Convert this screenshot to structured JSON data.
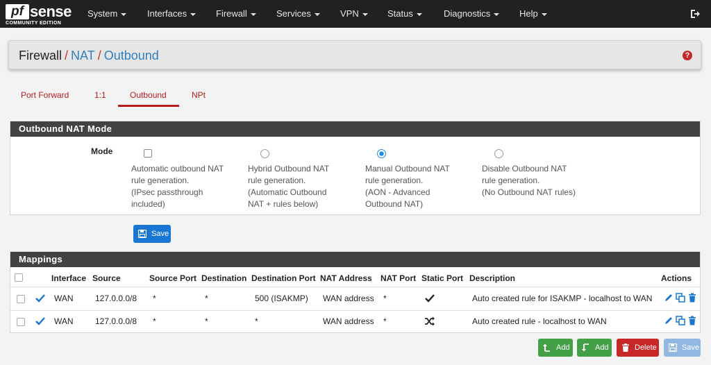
{
  "brand": {
    "logo": "pfsense",
    "logo_pf": "pf",
    "logo_sense": "sense",
    "edition": "COMMUNITY EDITION"
  },
  "nav": {
    "items": [
      {
        "label": "System"
      },
      {
        "label": "Interfaces"
      },
      {
        "label": "Firewall"
      },
      {
        "label": "Services"
      },
      {
        "label": "VPN"
      },
      {
        "label": "Status"
      },
      {
        "label": "Diagnostics"
      },
      {
        "label": "Help"
      }
    ],
    "logout_icon": "logout-icon"
  },
  "breadcrumb": {
    "root": "Firewall",
    "sep": "/",
    "level2": "NAT",
    "level3": "Outbound",
    "help_icon": "?"
  },
  "tabs": [
    {
      "label": "Port Forward"
    },
    {
      "label": "1:1"
    },
    {
      "label": "Outbound",
      "active": true
    },
    {
      "label": "NPt"
    }
  ],
  "mode_panel": {
    "title": "Outbound NAT Mode",
    "label": "Mode",
    "options": [
      {
        "control": "checkbox",
        "checked": false,
        "lines": [
          "Automatic outbound NAT",
          "rule generation.",
          "(IPsec passthrough",
          "included)"
        ]
      },
      {
        "control": "radio",
        "checked": false,
        "lines": [
          "Hybrid Outbound NAT",
          "rule generation.",
          "(Automatic Outbound",
          "NAT + rules below)"
        ]
      },
      {
        "control": "radio",
        "checked": true,
        "lines": [
          "Manual Outbound NAT",
          "rule generation.",
          "(AON - Advanced",
          "Outbound NAT)"
        ]
      },
      {
        "control": "radio",
        "checked": false,
        "lines": [
          "Disable Outbound NAT",
          "rule generation.",
          "(No Outbound NAT rules)"
        ]
      }
    ],
    "save_label": "Save"
  },
  "mappings": {
    "title": "Mappings",
    "columns": [
      "Interface",
      "Source",
      "Source Port",
      "Destination",
      "Destination Port",
      "NAT Address",
      "NAT Port",
      "Static Port",
      "Description",
      "Actions"
    ],
    "rows": [
      {
        "enabled": true,
        "interface": "WAN",
        "source": "127.0.0.0/8",
        "source_port": "*",
        "destination": "*",
        "destination_port": "500 (ISAKMP)",
        "nat_address": "WAN address",
        "nat_port": "*",
        "static_port_icon": "check-icon",
        "description": "Auto created rule for ISAKMP - localhost to WAN"
      },
      {
        "enabled": true,
        "interface": "WAN",
        "source": "127.0.0.0/8",
        "source_port": "*",
        "destination": "*",
        "destination_port": "*",
        "nat_address": "WAN address",
        "nat_port": "*",
        "static_port_icon": "shuffle-icon",
        "description": "Auto created rule - localhost to WAN"
      }
    ],
    "action_icons": [
      "pencil-icon",
      "copy-icon",
      "trash-icon"
    ]
  },
  "footer_buttons": {
    "add_top": "Add",
    "add_bottom": "Add",
    "delete": "Delete",
    "save": "Save"
  },
  "colors": {
    "navbar": "#212121",
    "panel_heading": "#424242",
    "accent_red": "#b71c1c",
    "link_blue": "#2f7ec1",
    "primary": "#1976d2",
    "success": "#43a047",
    "danger": "#c62828"
  }
}
